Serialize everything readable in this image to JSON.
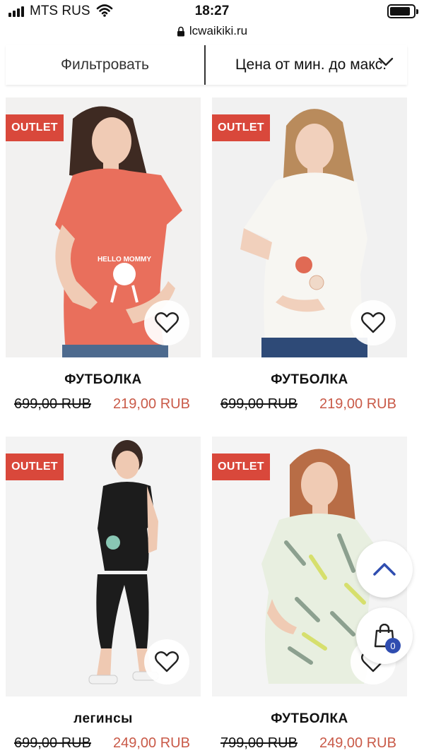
{
  "status_bar": {
    "carrier": "MTS RUS",
    "time": "18:27",
    "url": "lcwaikiki.ru"
  },
  "toolbar": {
    "filter_label": "Фильтровать",
    "sort_label": "Цена от мин. до макс."
  },
  "products": [
    {
      "badge": "OUTLET",
      "title": "ФУТБОЛКА",
      "old_price": "699,00 RUB",
      "price": "219,00 RUB",
      "color": "#e96f5c"
    },
    {
      "badge": "OUTLET",
      "title": "ФУТБОЛКА",
      "old_price": "699,00 RUB",
      "price": "219,00 RUB",
      "color": "#f7f6f2"
    },
    {
      "badge": "OUTLET",
      "title": "легинсы",
      "old_price": "699,00 RUB",
      "price": "249,00 RUB",
      "color": "#1c1c1c"
    },
    {
      "badge": "OUTLET",
      "title": "ФУТБОЛКА",
      "old_price": "799,00 RUB",
      "price": "249,00 RUB",
      "color": "#e8efe0"
    }
  ],
  "cart": {
    "count": "0"
  },
  "colors": {
    "badge": "#d9483b",
    "price": "#c95a48",
    "cart_badge": "#2f4db0",
    "scroll_top_arrow": "#2f4db0"
  }
}
